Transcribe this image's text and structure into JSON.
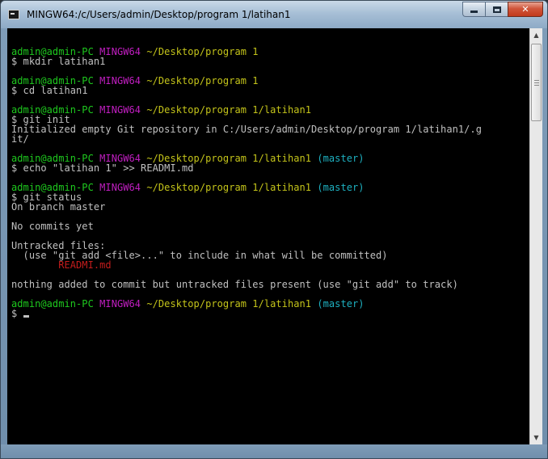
{
  "window": {
    "title": "MINGW64:/c/Users/admin/Desktop/program 1/latihan1",
    "minimize_label": "",
    "maximize_label": "",
    "close_label": "✕"
  },
  "colors": {
    "user": "#1ec91e",
    "system": "#c11ec1",
    "path": "#c4c41a",
    "branch": "#1eb0c0",
    "untracked": "#c41c1c",
    "text": "#c0c0c0",
    "background": "#000000"
  },
  "terminal": {
    "lines": [
      {
        "segments": []
      },
      {
        "segments": [
          {
            "text": "admin@admin-PC",
            "color": "user"
          },
          {
            "text": " "
          },
          {
            "text": "MINGW64",
            "color": "system"
          },
          {
            "text": " "
          },
          {
            "text": "~/Desktop/program 1",
            "color": "path"
          }
        ]
      },
      {
        "segments": [
          {
            "text": "$ mkdir latihan1"
          }
        ]
      },
      {
        "segments": []
      },
      {
        "segments": [
          {
            "text": "admin@admin-PC",
            "color": "user"
          },
          {
            "text": " "
          },
          {
            "text": "MINGW64",
            "color": "system"
          },
          {
            "text": " "
          },
          {
            "text": "~/Desktop/program 1",
            "color": "path"
          }
        ]
      },
      {
        "segments": [
          {
            "text": "$ cd latihan1"
          }
        ]
      },
      {
        "segments": []
      },
      {
        "segments": [
          {
            "text": "admin@admin-PC",
            "color": "user"
          },
          {
            "text": " "
          },
          {
            "text": "MINGW64",
            "color": "system"
          },
          {
            "text": " "
          },
          {
            "text": "~/Desktop/program 1/latihan1",
            "color": "path"
          }
        ]
      },
      {
        "segments": [
          {
            "text": "$ git init"
          }
        ]
      },
      {
        "segments": [
          {
            "text": "Initialized empty Git repository in C:/Users/admin/Desktop/program 1/latihan1/.g"
          }
        ]
      },
      {
        "segments": [
          {
            "text": "it/"
          }
        ]
      },
      {
        "segments": []
      },
      {
        "segments": [
          {
            "text": "admin@admin-PC",
            "color": "user"
          },
          {
            "text": " "
          },
          {
            "text": "MINGW64",
            "color": "system"
          },
          {
            "text": " "
          },
          {
            "text": "~/Desktop/program 1/latihan1",
            "color": "path"
          },
          {
            "text": " "
          },
          {
            "text": "(master)",
            "color": "branch"
          }
        ]
      },
      {
        "segments": [
          {
            "text": "$ echo \"latihan 1\" >> READMI.md"
          }
        ]
      },
      {
        "segments": []
      },
      {
        "segments": [
          {
            "text": "admin@admin-PC",
            "color": "user"
          },
          {
            "text": " "
          },
          {
            "text": "MINGW64",
            "color": "system"
          },
          {
            "text": " "
          },
          {
            "text": "~/Desktop/program 1/latihan1",
            "color": "path"
          },
          {
            "text": " "
          },
          {
            "text": "(master)",
            "color": "branch"
          }
        ]
      },
      {
        "segments": [
          {
            "text": "$ git status"
          }
        ]
      },
      {
        "segments": [
          {
            "text": "On branch master"
          }
        ]
      },
      {
        "segments": []
      },
      {
        "segments": [
          {
            "text": "No commits yet"
          }
        ]
      },
      {
        "segments": []
      },
      {
        "segments": [
          {
            "text": "Untracked files:"
          }
        ]
      },
      {
        "segments": [
          {
            "text": "  (use \"git add <file>...\" to include in what will be committed)"
          }
        ]
      },
      {
        "segments": [
          {
            "text": "        "
          },
          {
            "text": "READMI.md",
            "color": "untracked"
          }
        ]
      },
      {
        "segments": []
      },
      {
        "segments": [
          {
            "text": "nothing added to commit but untracked files present (use \"git add\" to track)"
          }
        ]
      },
      {
        "segments": []
      },
      {
        "segments": [
          {
            "text": "admin@admin-PC",
            "color": "user"
          },
          {
            "text": " "
          },
          {
            "text": "MINGW64",
            "color": "system"
          },
          {
            "text": " "
          },
          {
            "text": "~/Desktop/program 1/latihan1",
            "color": "path"
          },
          {
            "text": " "
          },
          {
            "text": "(master)",
            "color": "branch"
          }
        ]
      },
      {
        "segments": [
          {
            "text": "$ "
          }
        ],
        "cursor": true
      }
    ]
  },
  "scrollbar": {
    "up_arrow_icon": "▲",
    "down_arrow_icon": "▼"
  }
}
